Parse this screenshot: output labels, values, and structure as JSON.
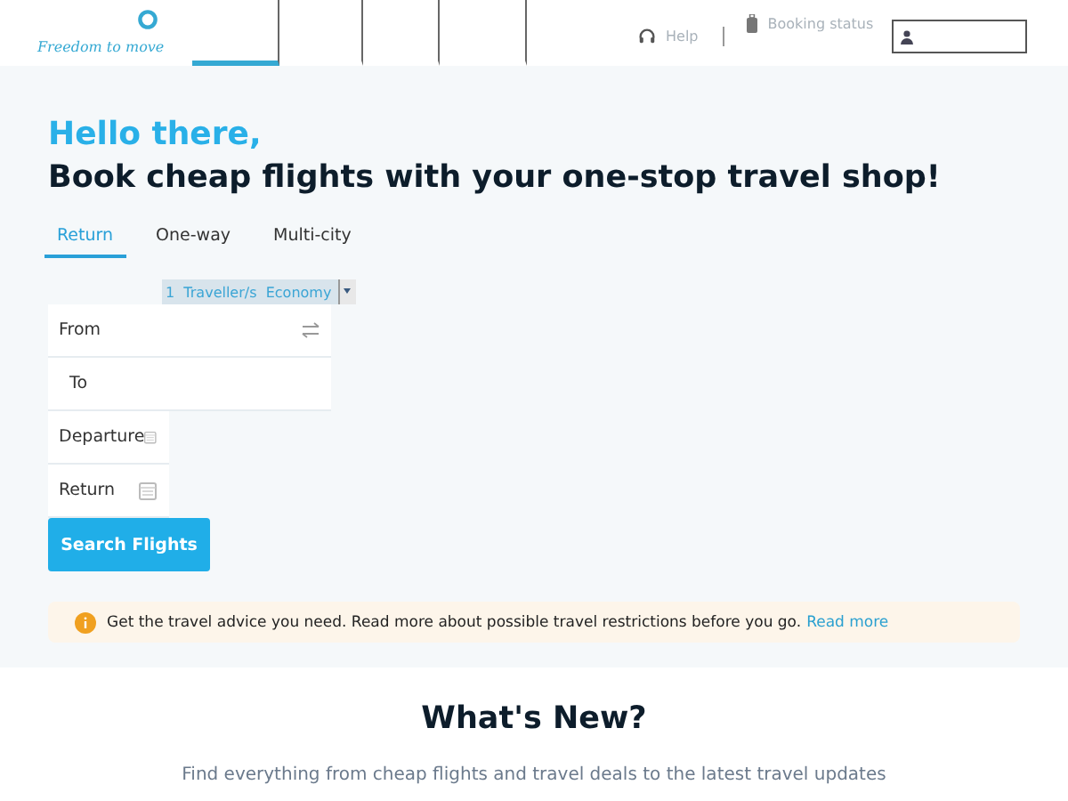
{
  "header": {
    "logo_tagline": "Freedom to move",
    "nav_tabs": [
      {
        "selected": true
      },
      {
        "selected": false
      },
      {
        "selected": false
      },
      {
        "selected": false
      }
    ],
    "help": "Help",
    "booking_status": "Booking status"
  },
  "hero": {
    "greeting": "Hello there,",
    "headline": "Book cheap flights with your one-stop travel shop!"
  },
  "trip_tabs": [
    {
      "label": "Return",
      "selected": true
    },
    {
      "label": "One-way",
      "selected": false
    },
    {
      "label": "Multi-city",
      "selected": false
    }
  ],
  "travellers": "1  Traveller/s  Economy",
  "fields": {
    "from": "From",
    "to": "To",
    "departure": "Departure",
    "return": "Return"
  },
  "search_button": "Search Flights",
  "advice": {
    "text": "Get the travel advice you need. Read more about possible travel restrictions before you go.",
    "link": "Read more"
  },
  "whats_new": {
    "title": "What's New?",
    "subtitle": "Find everything from cheap flights and travel deals to the latest travel updates"
  }
}
